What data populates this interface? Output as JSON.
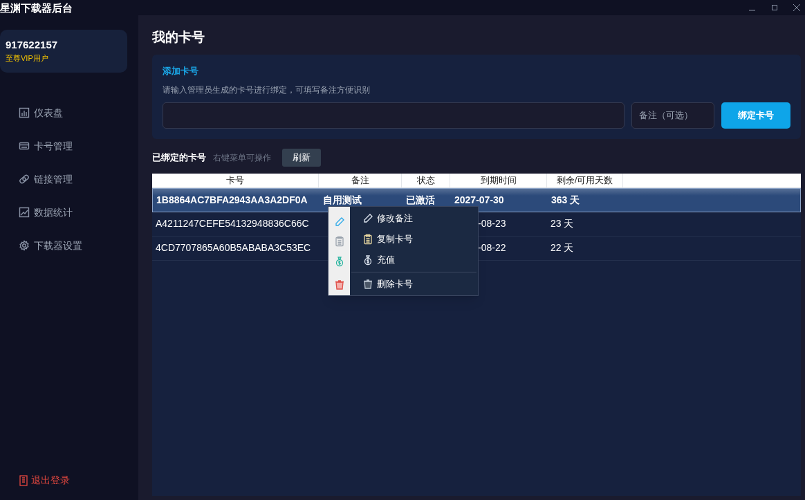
{
  "window": {
    "title": "星渊下载器后台"
  },
  "user": {
    "id": "917622157",
    "tier": "至尊VIP用户"
  },
  "sidebar": {
    "items": [
      {
        "label": "仪表盘",
        "kind": "chart",
        "selected": false
      },
      {
        "label": "卡号管理",
        "kind": "card",
        "selected": false
      },
      {
        "label": "链接管理",
        "kind": "link",
        "selected": false
      },
      {
        "label": "数据统计",
        "kind": "trend",
        "selected": false
      },
      {
        "label": "下载器设置",
        "kind": "gear",
        "selected": false
      }
    ],
    "logout": "退出登录"
  },
  "page_title": "我的卡号",
  "add_card": {
    "title": "添加卡号",
    "hint": "请输入管理员生成的卡号进行绑定，可填写备注方便识别",
    "note_placeholder": "备注（可选）",
    "button": "绑定卡号"
  },
  "bound": {
    "title": "已绑定的卡号",
    "hint": "右键菜单可操作",
    "refresh": "刷新"
  },
  "table": {
    "columns": [
      "卡号",
      "备注",
      "状态",
      "到期时间",
      "剩余/可用天数"
    ],
    "rows": [
      {
        "selected": true,
        "cells": [
          "1B8864AC7BFA2943AA3A2DF0A",
          "自用测试",
          "已激活",
          "2027-07-30",
          "363 天"
        ]
      },
      {
        "selected": false,
        "cells": [
          "A4211247CEFE54132948836C66C",
          "",
          "",
          "-08-23",
          "23 天"
        ]
      },
      {
        "selected": false,
        "cells": [
          "4CD7707865A60B5ABABA3C53EC",
          "",
          "",
          "-08-22",
          "22 天"
        ]
      }
    ]
  },
  "context_menu": {
    "items": [
      {
        "label": "修改备注",
        "kind": "edit"
      },
      {
        "label": "复制卡号",
        "kind": "copy"
      },
      {
        "label": "充值",
        "kind": "recharge"
      },
      {
        "label": "删除卡号",
        "kind": "delete"
      }
    ]
  }
}
